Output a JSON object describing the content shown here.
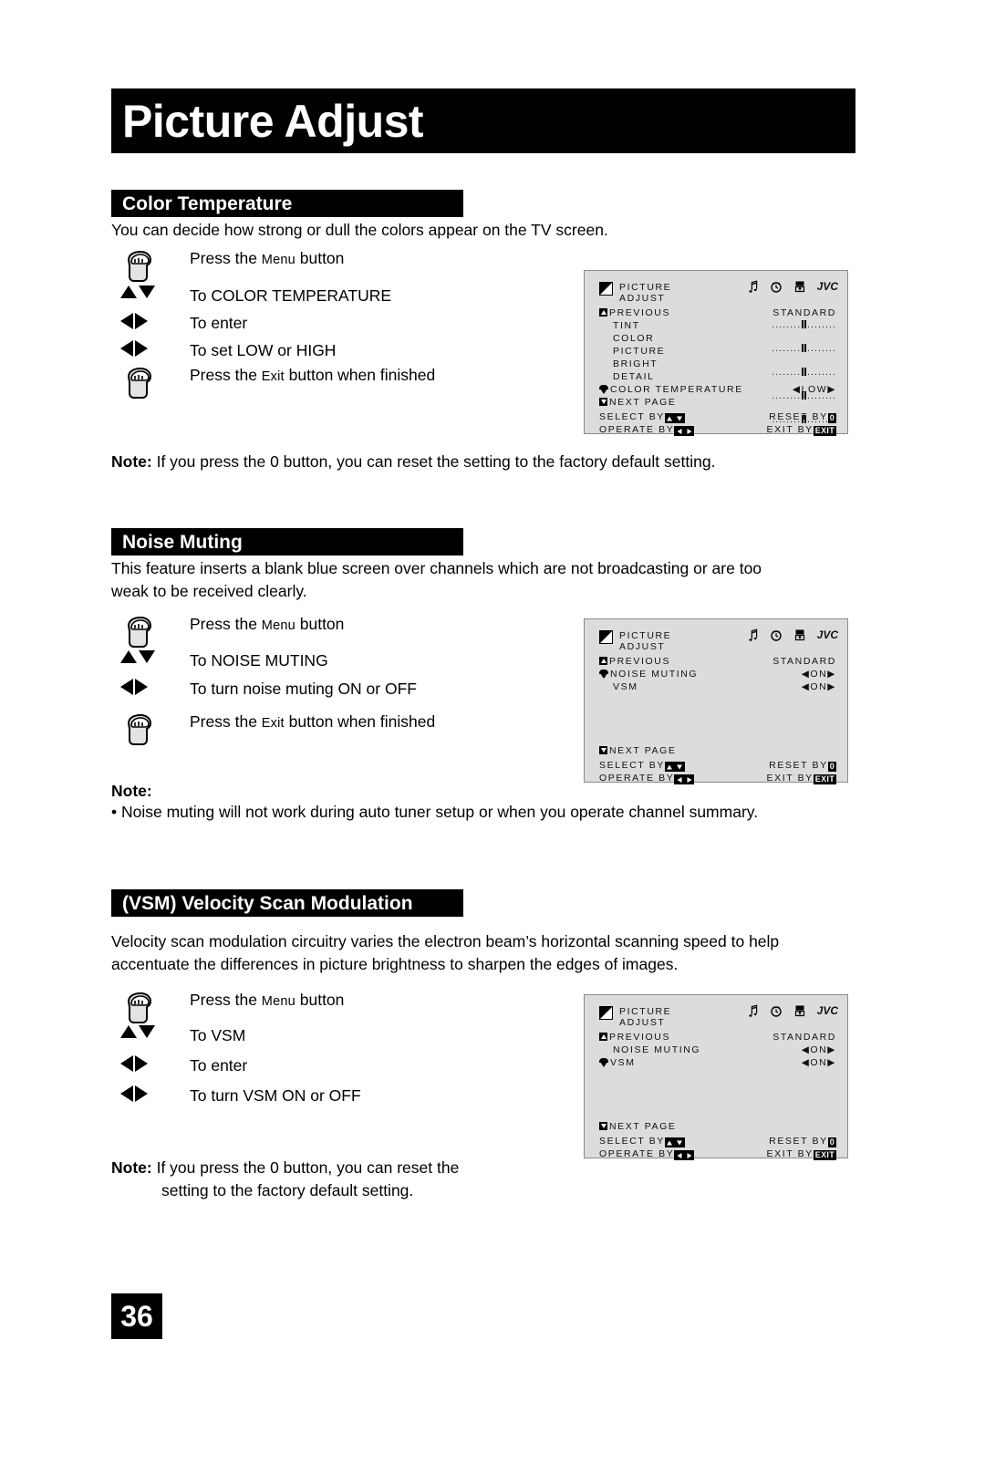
{
  "page": {
    "title": "Picture Adjust",
    "page_number": "36"
  },
  "sections": [
    {
      "heading": "Color Temperature",
      "intro": "You can decide how strong or dull the colors appear on the TV screen.",
      "steps": [
        {
          "icon": "hand-press-icon",
          "text": "Press the ",
          "small": "Menu",
          "tail": " button"
        },
        {
          "icon": "up-down-arrows-icon",
          "text": "To COLOR TEMPERATURE"
        },
        {
          "icon": "left-right-arrows-icon",
          "text": "To enter"
        },
        {
          "icon": "left-right-arrows-icon",
          "text": "To set LOW or HIGH"
        },
        {
          "icon": "hand-press-icon",
          "text": "Press the ",
          "small": "Exit",
          "tail": " button when finished"
        }
      ],
      "note_label": "Note:",
      "note_text": " If you press the 0 button, you can reset the setting to the factory default setting."
    },
    {
      "heading": "Noise Muting",
      "intro_line1": "This feature inserts a blank blue screen over channels which are not broadcasting or are too",
      "intro_line2": "weak to be received clearly.",
      "steps": [
        {
          "icon": "hand-press-icon",
          "text": "Press the ",
          "small": "Menu",
          "tail": " button"
        },
        {
          "icon": "up-down-arrows-icon",
          "text": "To NOISE MUTING"
        },
        {
          "icon": "left-right-arrows-icon",
          "text": "To turn noise muting ON or OFF"
        },
        {
          "icon": "hand-press-icon",
          "text": "Press the ",
          "small": "Exit",
          "tail": " button when finished"
        }
      ],
      "note_label": "Note:",
      "note_bullet": "•  Noise muting will not work during auto tuner setup or when you operate channel summary."
    },
    {
      "heading": "(VSM) Velocity Scan Modulation",
      "intro_line1": "Velocity scan modulation circuitry varies the electron beam’s horizontal scanning speed to help",
      "intro_line2": "accentuate the differences in picture brightness to sharpen the edges of images.",
      "steps": [
        {
          "icon": "hand-press-icon",
          "text": "Press the ",
          "small": "Menu",
          "tail": " button"
        },
        {
          "icon": "up-down-arrows-icon",
          "text": "To VSM"
        },
        {
          "icon": "left-right-arrows-icon",
          "text": "To enter"
        },
        {
          "icon": "left-right-arrows-icon",
          "text": "To turn VSM ON or OFF"
        }
      ],
      "note_label": "Note:",
      "note_line1": " If you press the 0 button, you can reset the",
      "note_line2": "setting to the factory default setting."
    }
  ],
  "osd_menus": [
    {
      "id": "osd-color-temperature",
      "title_line1": "PICTURE",
      "title_line2": "ADJUST",
      "icons": [
        "music-note-icon",
        "clock-icon",
        "setup-icon",
        "JVC"
      ],
      "previous": "PREVIOUS",
      "preset": "STANDARD",
      "items": [
        {
          "label": "TINT",
          "type": "slider"
        },
        {
          "label": "COLOR",
          "type": "slider"
        },
        {
          "label": "PICTURE",
          "type": "slider"
        },
        {
          "label": "BRIGHT",
          "type": "slider"
        },
        {
          "label": "DETAIL",
          "type": "slider"
        }
      ],
      "selected": {
        "label": "COLOR TEMPERATURE",
        "value": "◀LOW▶"
      },
      "next_page": "NEXT PAGE",
      "footer": {
        "select": "SELECT   BY",
        "operate": "OPERATE BY",
        "reset": "RESET BY",
        "reset_key": "0",
        "exit": "EXIT BY",
        "exit_key": "EXIT"
      }
    },
    {
      "id": "osd-noise-muting",
      "title_line1": "PICTURE",
      "title_line2": "ADJUST",
      "icons": [
        "music-note-icon",
        "clock-icon",
        "setup-icon",
        "JVC"
      ],
      "previous": "PREVIOUS",
      "preset": "STANDARD",
      "items": [
        {
          "label": "NOISE MUTING",
          "value": "◀ON▶",
          "selected": true
        },
        {
          "label": "VSM",
          "value": "◀ON▶",
          "selected": false
        }
      ],
      "next_page": "NEXT PAGE",
      "footer": {
        "select": "SELECT   BY",
        "operate": "OPERATE BY",
        "reset": "RESET BY",
        "reset_key": "0",
        "exit": "EXIT BY",
        "exit_key": "EXIT"
      }
    },
    {
      "id": "osd-vsm",
      "title_line1": "PICTURE",
      "title_line2": "ADJUST",
      "icons": [
        "music-note-icon",
        "clock-icon",
        "setup-icon",
        "JVC"
      ],
      "previous": "PREVIOUS",
      "preset": "STANDARD",
      "items": [
        {
          "label": "NOISE MUTING",
          "value": "◀ON▶",
          "selected": false
        },
        {
          "label": "VSM",
          "value": "◀ON▶",
          "selected": true
        }
      ],
      "next_page": "NEXT PAGE",
      "footer": {
        "select": "SELECT   BY",
        "operate": "OPERATE BY",
        "reset": "RESET BY",
        "reset_key": "0",
        "exit": "EXIT BY",
        "exit_key": "EXIT"
      }
    }
  ],
  "colors": {
    "bar_background": "#000000",
    "bar_text": "#ffffff",
    "osd_background": "#dcdcdc",
    "osd_border": "#8b8b8b",
    "page_background": "#ffffff"
  }
}
